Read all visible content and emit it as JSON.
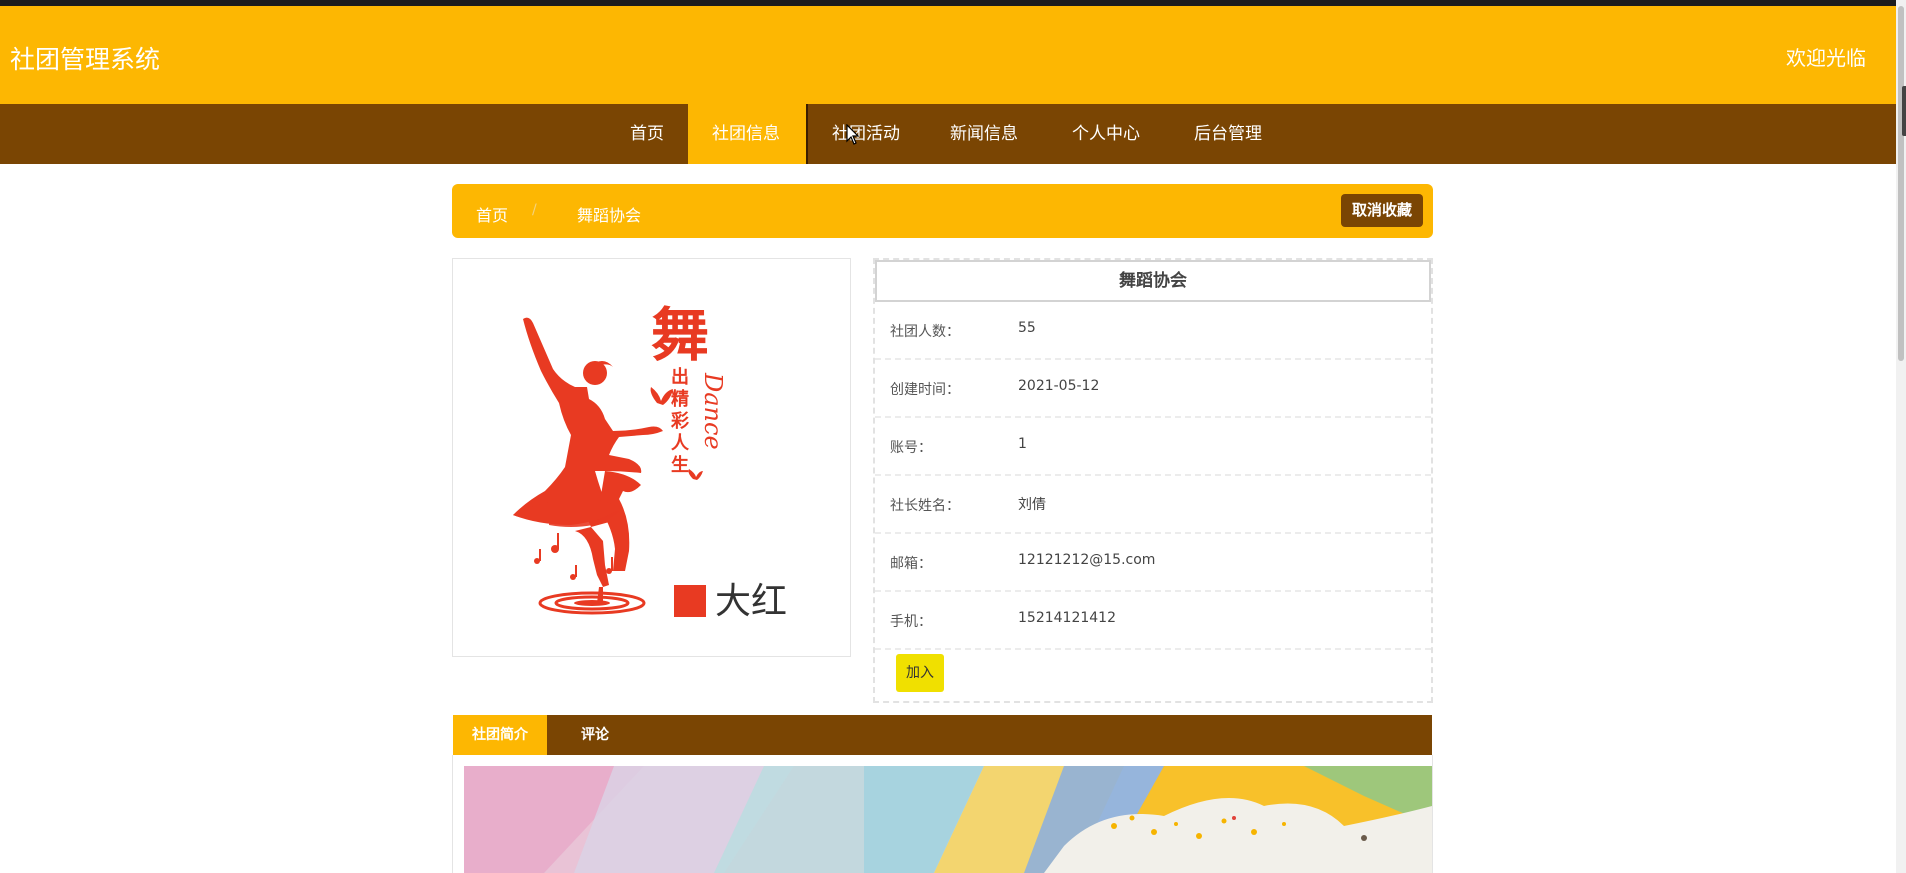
{
  "header": {
    "site_title": "社团管理系统",
    "welcome": "欢迎光临"
  },
  "nav": {
    "items": [
      {
        "label": "首页"
      },
      {
        "label": "社团信息"
      },
      {
        "label": "社团活动"
      },
      {
        "label": "新闻信息"
      },
      {
        "label": "个人中心"
      },
      {
        "label": "后台管理"
      }
    ]
  },
  "breadcrumb": {
    "home": "首页",
    "separator": "/",
    "current": "舞蹈协会",
    "uncollect_button": "取消收藏"
  },
  "poster": {
    "vertical_text": "舞出精彩人生",
    "script_text": "Dance",
    "color_label": "大红"
  },
  "club": {
    "name": "舞蹈协会",
    "fields": [
      {
        "label": "社团人数：",
        "value": "55"
      },
      {
        "label": "创建时间：",
        "value": "2021-05-12"
      },
      {
        "label": "账号：",
        "value": "1"
      },
      {
        "label": "社长姓名：",
        "value": "刘倩"
      },
      {
        "label": "邮箱：",
        "value": "12121212@15.com"
      },
      {
        "label": "手机：",
        "value": "15214121412"
      }
    ],
    "join_button": "加入"
  },
  "tabs": [
    {
      "label": "社团简介"
    },
    {
      "label": "评论"
    }
  ],
  "colors": {
    "accent": "#FDB702",
    "nav_brown": "#7A4503",
    "join_yellow": "#F0E000",
    "poster_red": "#E83A22"
  }
}
